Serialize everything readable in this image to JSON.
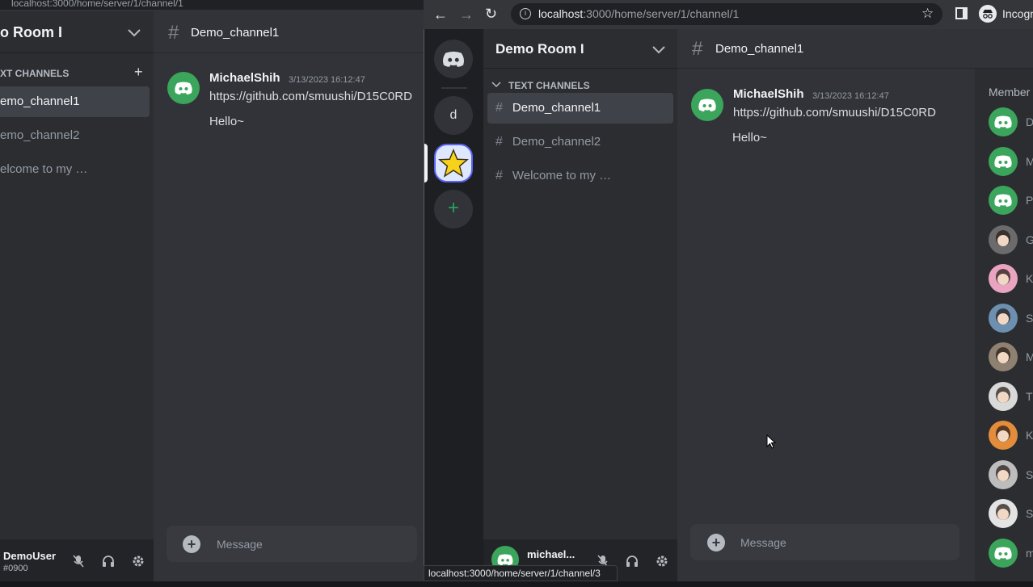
{
  "colors": {
    "accent": "#5865f2",
    "green": "#23a55a",
    "avatar_green": "#3ba55c",
    "bg": "#313338",
    "sidebar": "#2b2d31",
    "rail": "#1e1f22"
  },
  "background_window": {
    "url_fragment": "localhost:3000/home/server/1/channel/1",
    "room_name": "o Room I",
    "section_label": "XT CHANNELS",
    "add_icon": "plus-icon",
    "channels": [
      "emo_channel1",
      "emo_channel2",
      "elcome to my …"
    ],
    "user": {
      "name": "DemoUser",
      "tag": "#0900"
    },
    "channel_title": "Demo_channel1",
    "message": {
      "author": "MichaelShih",
      "time": "3/13/2023 16:12:47",
      "lines": [
        "https://github.com/smuushi/D15C0RD",
        "Hello~"
      ]
    },
    "input_placeholder": "Message"
  },
  "browser": {
    "url_host": "localhost",
    "url_path": ":3000/home/server/1/channel/1",
    "profile_label": "Incogn",
    "status_bar": "localhost:3000/home/server/1/channel/3"
  },
  "servers": {
    "letter_server": "d",
    "add_icon": "+"
  },
  "sidebar": {
    "room_name": "Demo Room I",
    "section_label": "TEXT CHANNELS",
    "channels": [
      {
        "name": "Demo_channel1",
        "active": true
      },
      {
        "name": "Demo_channel2",
        "active": false
      },
      {
        "name": "Welcome to my …",
        "active": false
      }
    ],
    "user": {
      "name": "michael..."
    }
  },
  "chat": {
    "hash": "#",
    "channel_title": "Demo_channel1",
    "message": {
      "author": "MichaelShih",
      "time": "3/13/2023 16:12:47",
      "lines": [
        "https://github.com/smuushi/D15C0RD",
        "Hello~"
      ]
    },
    "input_placeholder": "Message"
  },
  "members": {
    "title": "Member",
    "list": [
      {
        "initial": "D",
        "avatar": "discord-logo",
        "color": "#3ba55c"
      },
      {
        "initial": "M",
        "avatar": "discord-logo",
        "color": "#3ba55c"
      },
      {
        "initial": "P",
        "avatar": "discord-logo",
        "color": "#3ba55c"
      },
      {
        "initial": "G",
        "avatar": "photo",
        "color": "#6b6b6b"
      },
      {
        "initial": "K",
        "avatar": "photo",
        "color": "#e8a4c0"
      },
      {
        "initial": "Sa",
        "avatar": "photo",
        "color": "#6d8fb0"
      },
      {
        "initial": "M",
        "avatar": "photo",
        "color": "#8f8172"
      },
      {
        "initial": "T",
        "avatar": "photo",
        "color": "#d9d9d9"
      },
      {
        "initial": "K",
        "avatar": "photo",
        "color": "#e38c3c"
      },
      {
        "initial": "Sa",
        "avatar": "photo",
        "color": "#bdbdbd"
      },
      {
        "initial": "Sh",
        "avatar": "photo",
        "color": "#e3e3e3"
      },
      {
        "initial": "m",
        "avatar": "discord-logo",
        "color": "#3ba55c"
      }
    ]
  }
}
